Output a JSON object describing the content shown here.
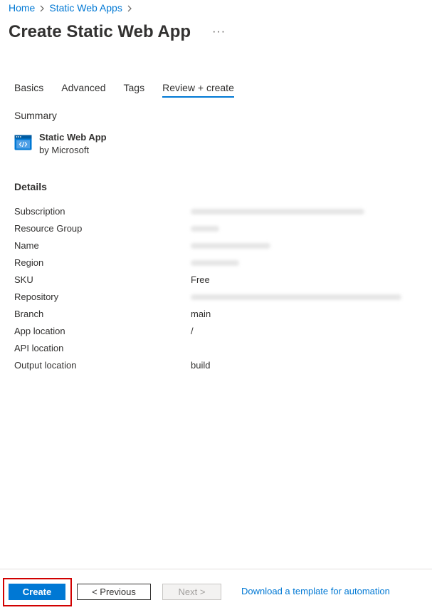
{
  "breadcrumb": {
    "items": [
      "Home",
      "Static Web Apps"
    ]
  },
  "header": {
    "title": "Create Static Web App",
    "more": "···"
  },
  "tabs": [
    {
      "label": "Basics",
      "active": false
    },
    {
      "label": "Advanced",
      "active": false
    },
    {
      "label": "Tags",
      "active": false
    },
    {
      "label": "Review + create",
      "active": true
    }
  ],
  "summary": {
    "label": "Summary",
    "app_name": "Static Web App",
    "app_vendor": "by Microsoft",
    "icon": "static-web-app-icon"
  },
  "details": {
    "label": "Details",
    "rows": [
      {
        "key": "Subscription",
        "value": "",
        "blurred": true
      },
      {
        "key": "Resource Group",
        "value": "",
        "blurred": true
      },
      {
        "key": "Name",
        "value": "",
        "blurred": true
      },
      {
        "key": "Region",
        "value": "",
        "blurred": true
      },
      {
        "key": "SKU",
        "value": "Free",
        "blurred": false
      },
      {
        "key": "Repository",
        "value": "",
        "blurred": true
      },
      {
        "key": "Branch",
        "value": "main",
        "blurred": false
      },
      {
        "key": "App location",
        "value": "/",
        "blurred": false
      },
      {
        "key": "API location",
        "value": "",
        "blurred": false
      },
      {
        "key": "Output location",
        "value": "build",
        "blurred": false
      }
    ]
  },
  "footer": {
    "create_label": "Create",
    "previous_label": "< Previous",
    "next_label": "Next >",
    "download_label": "Download a template for automation"
  },
  "colors": {
    "accent": "#0078d4",
    "highlight": "#d10000"
  }
}
